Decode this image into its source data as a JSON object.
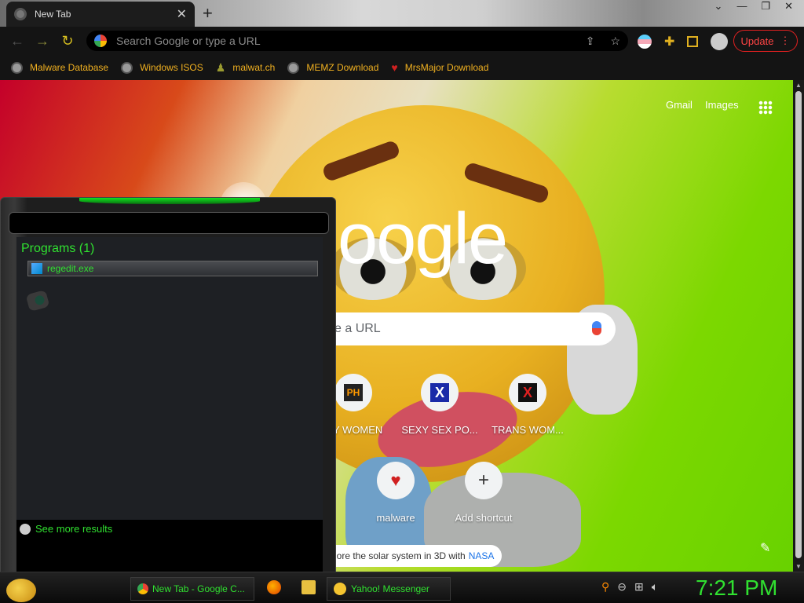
{
  "browser": {
    "tab_title": "New Tab",
    "new_tab_glyph": "+",
    "omnibox_placeholder": "Search Google or type a URL",
    "update_label": "Update",
    "update_menu_glyph": "⋮"
  },
  "bookmarks": [
    {
      "label": "Malware Database",
      "icon": "globe-icon"
    },
    {
      "label": "Windows ISOS",
      "icon": "globe-icon"
    },
    {
      "label": "malwat.ch",
      "icon": "person-icon"
    },
    {
      "label": "MEMZ Download",
      "icon": "globe-icon"
    },
    {
      "label": "MrsMajor Download",
      "icon": "heart-icon"
    }
  ],
  "ntp": {
    "gmail": "Gmail",
    "images": "Images",
    "logo_text": "oogle",
    "search_placeholder_fragment": "e a URL",
    "shortcuts": [
      {
        "label": "Y WOMEN",
        "badge": "PH"
      },
      {
        "label": "SEXY SEX PO...",
        "badge": "X"
      },
      {
        "label": "TRANS WOM...",
        "badge": "X"
      },
      {
        "label": "malware",
        "badge": "♥"
      },
      {
        "label": "Add shortcut",
        "badge": "+"
      }
    ],
    "promo_text": "lore the solar system in 3D with",
    "promo_link": "NASA"
  },
  "start_menu": {
    "programs_heading": "Programs (1)",
    "program_item": "regedit.exe",
    "see_more": "See more results"
  },
  "taskbar": {
    "chrome_task": "New Tab - Google C...",
    "yahoo_task": "Yahoo! Messenger",
    "clock": "7:21 PM"
  },
  "colors": {
    "accent_green": "#30e030",
    "bookmark_text": "#f0b020",
    "update_red": "#ff4444"
  }
}
